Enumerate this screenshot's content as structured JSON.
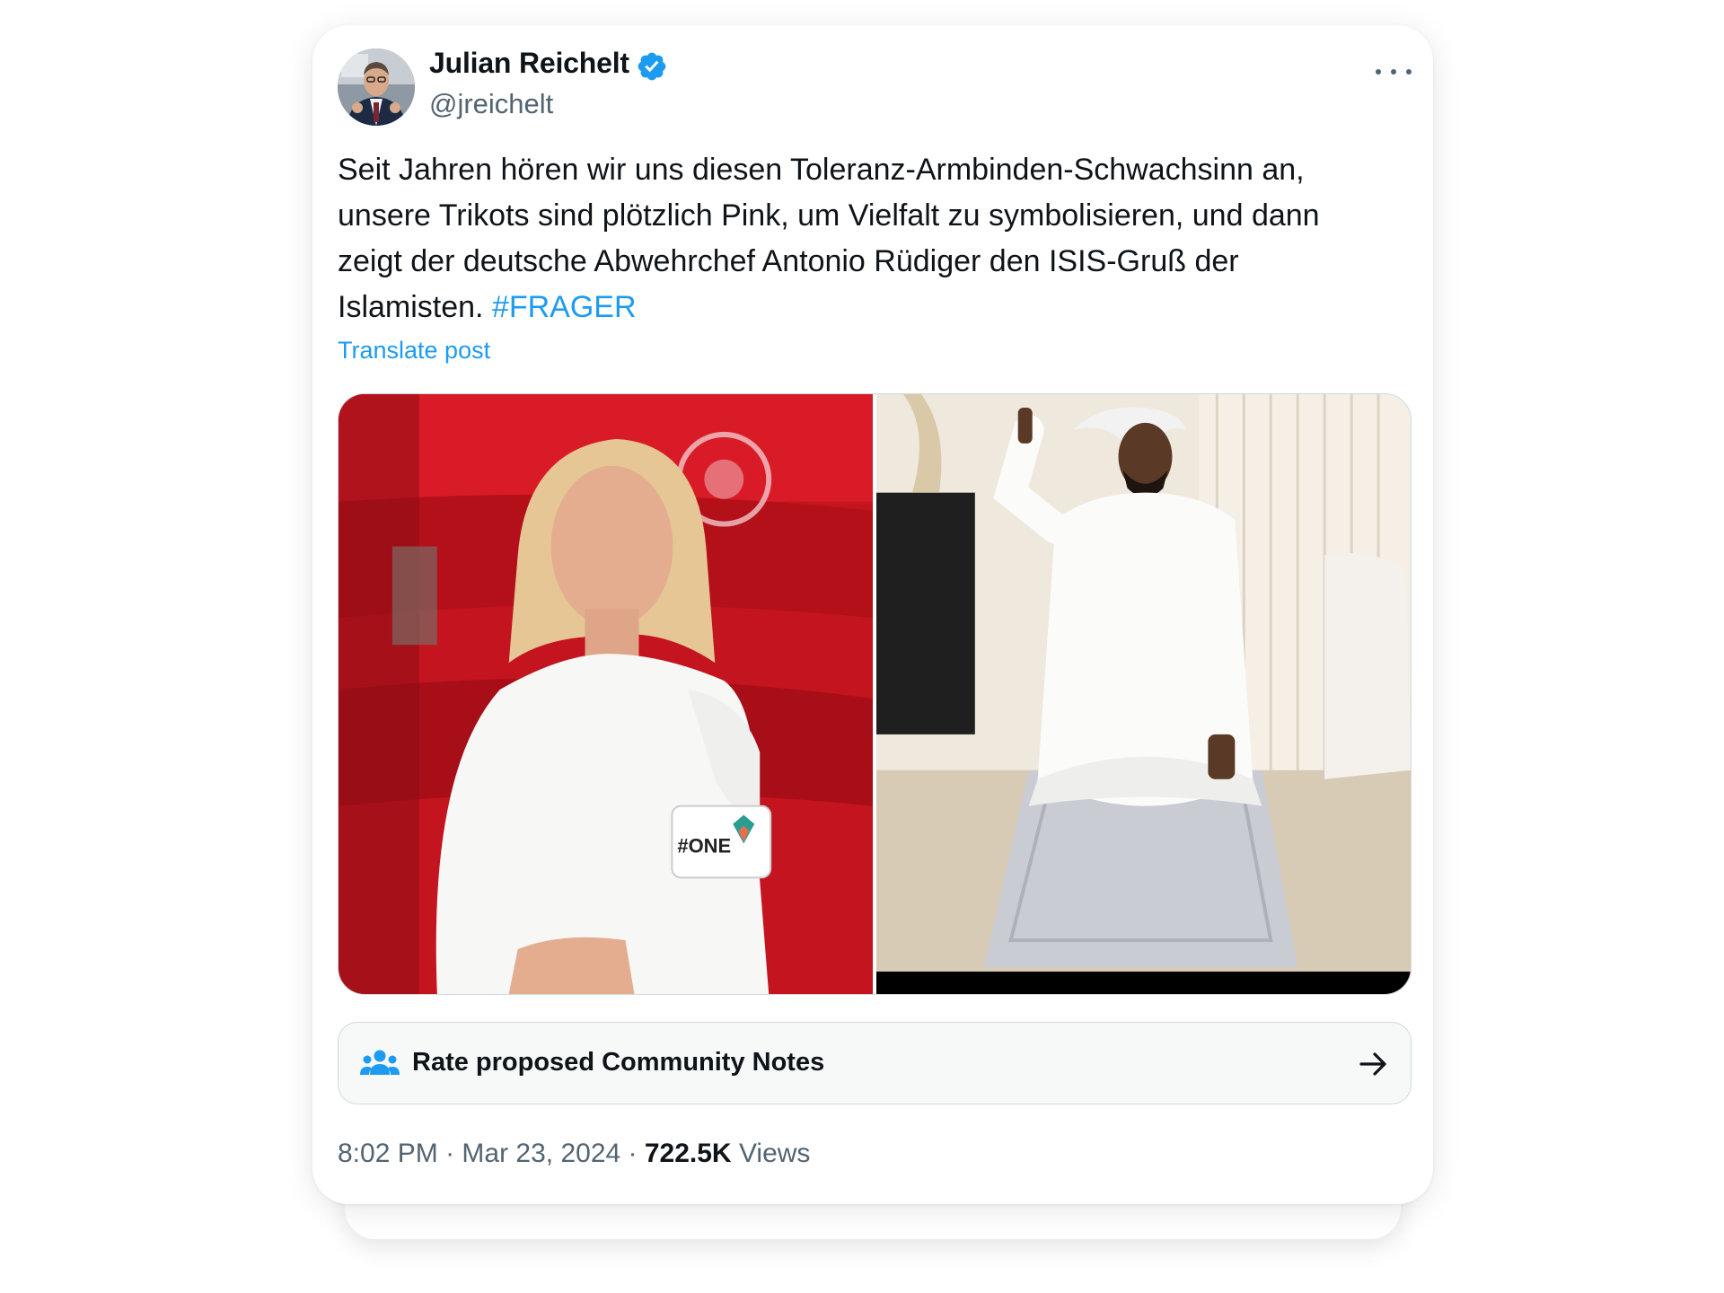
{
  "author": {
    "display_name": "Julian Reichelt",
    "handle": "@jreichelt",
    "verified": true,
    "verified_color": "#1d9bf0"
  },
  "post": {
    "text_lines": [
      "Seit Jahren hören wir uns diesen Toleranz-Armbinden-Schwachsinn an,",
      "unsere Trikots sind plötzlich Pink, um Vielfalt zu symbolisieren, und dann",
      "zeigt der deutsche Abwehrchef Antonio Rüdiger den ISIS-Gruß der",
      "Islamisten. "
    ],
    "hashtag": "#FRAGER",
    "translate_label": "Translate post",
    "armband_text": "#ONE"
  },
  "community_notes": {
    "label": "Rate proposed Community Notes"
  },
  "meta": {
    "time": "8:02 PM",
    "separator": " · ",
    "date": "Mar 23, 2024",
    "views_count": "722.5K",
    "views_label": "Views"
  },
  "icons": {
    "more": "more-horizontal-icon",
    "verified": "verified-badge-icon",
    "community": "people-group-icon",
    "arrow": "arrow-right-icon"
  },
  "colors": {
    "accent": "#1d9bf0",
    "text_primary": "#0f1419",
    "text_secondary": "#536471"
  }
}
